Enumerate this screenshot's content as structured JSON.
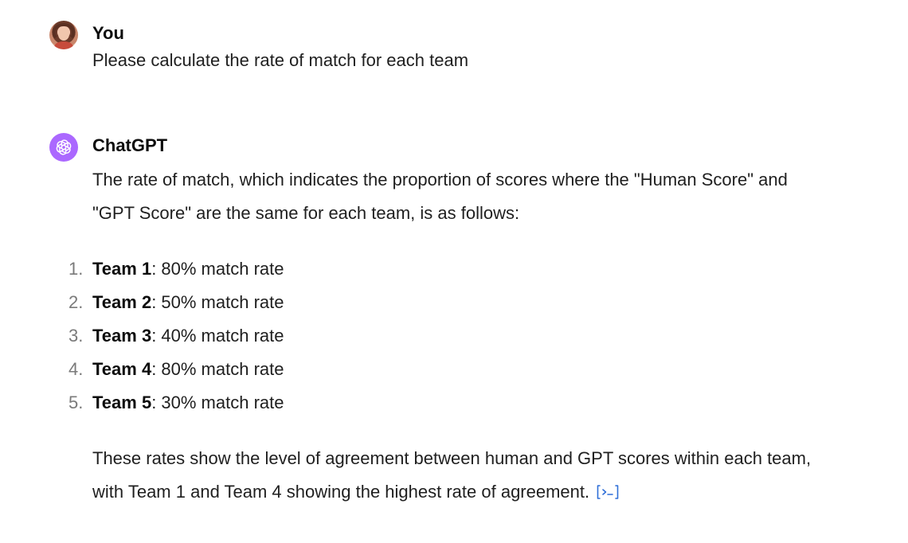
{
  "conversation": {
    "user": {
      "author": "You",
      "message": "Please calculate the rate of match for each team"
    },
    "assistant": {
      "author": "ChatGPT",
      "intro": "The rate of match, which indicates the proportion of scores where the \"Human Score\" and \"GPT Score\" are the same for each team, is as follows:",
      "items": [
        {
          "num": "1.",
          "team": "Team 1",
          "rate": ": 80% match rate"
        },
        {
          "num": "2.",
          "team": "Team 2",
          "rate": ": 50% match rate"
        },
        {
          "num": "3.",
          "team": "Team 3",
          "rate": ": 40% match rate"
        },
        {
          "num": "4.",
          "team": "Team 4",
          "rate": ": 80% match rate"
        },
        {
          "num": "5.",
          "team": "Team 5",
          "rate": ": 30% match rate"
        }
      ],
      "conclusion": "These rates show the level of agreement between human and GPT scores within each team, with Team 1 and Team 4 showing the highest rate of agreement."
    }
  },
  "icons": {
    "user_avatar": "user-avatar",
    "assistant_avatar": "openai-logo-icon",
    "code_link": "code-interpreter-icon"
  },
  "colors": {
    "assistant_avatar_bg": "#ab68ff",
    "link": "#2f6fd8",
    "text": "#1f1f1f"
  }
}
